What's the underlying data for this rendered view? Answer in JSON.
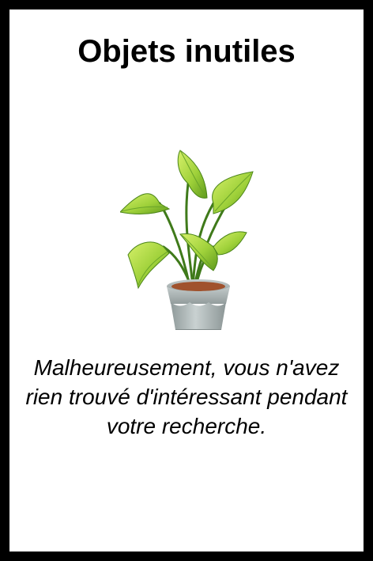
{
  "card": {
    "title": "Objets inutiles",
    "message": "Malheureusement, vous n'avez rien trouvé d'intéressant pendant votre recherche.",
    "illustration_icon": "potted-plant-icon"
  },
  "colors": {
    "frame": "#000000",
    "background": "#ffffff",
    "leaf_light": "#b6e04a",
    "leaf_dark": "#5f9a1c",
    "pot": "#a9b3b3",
    "soil": "#a0522d"
  }
}
